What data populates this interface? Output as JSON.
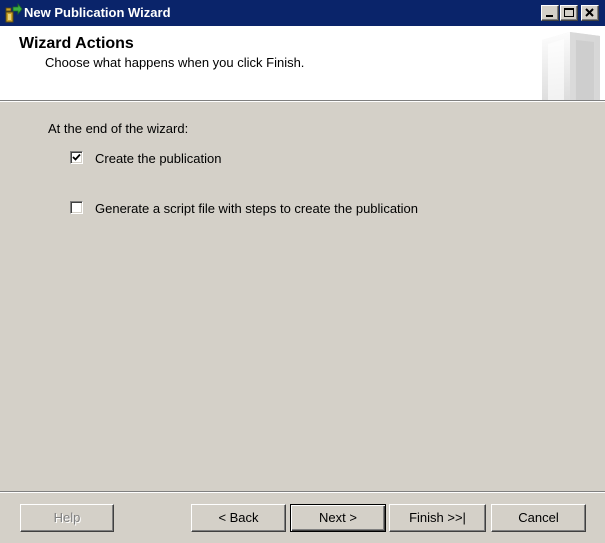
{
  "window": {
    "title": "New Publication Wizard",
    "title_bar_color": "#0a246a",
    "app_icon": "wizard-app-icon",
    "controls": {
      "minimize_icon": "minimize-icon",
      "maximize_icon": "maximize-icon",
      "close_icon": "close-icon"
    }
  },
  "header": {
    "title": "Wizard Actions",
    "subtitle": "Choose what happens when you click Finish.",
    "art_icon": "book-graphic-icon"
  },
  "body": {
    "intro": "At the end of the wizard:",
    "options": [
      {
        "label": "Create the publication",
        "checked": true
      },
      {
        "label": "Generate a script file with steps to create the publication",
        "checked": false
      }
    ]
  },
  "footer": {
    "help_label": "Help",
    "help_enabled": false,
    "back_label": "< Back",
    "next_label": "Next >",
    "finish_label": "Finish >>|",
    "cancel_label": "Cancel",
    "default_button": "Next >"
  },
  "colors": {
    "dialog_background": "#d4d0c8",
    "header_background": "#ffffff"
  }
}
